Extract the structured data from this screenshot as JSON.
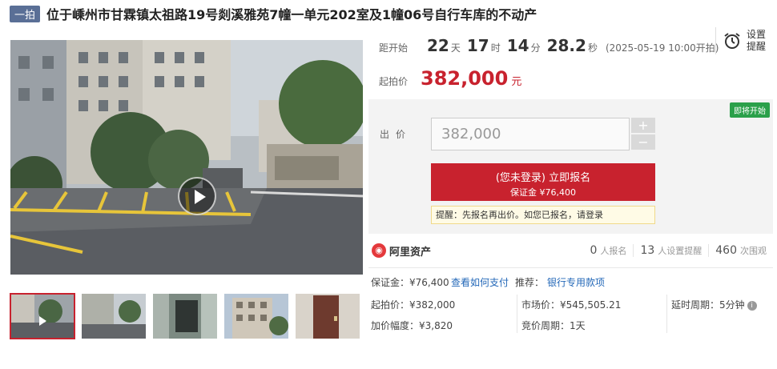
{
  "title": {
    "round_badge": "一拍",
    "text": "位于嵊州市甘霖镇太祖路19号剡溪雅苑7幢一单元202室及1幢06号自行车库的不动产"
  },
  "countdown": {
    "label": "距开始",
    "days": "22",
    "days_unit": "天",
    "hours": "17",
    "hours_unit": "时",
    "minutes": "14",
    "minutes_unit": "分",
    "seconds": "28.2",
    "seconds_unit": "秒",
    "start_time": "(2025-05-19 10:00开拍)"
  },
  "start_price": {
    "label": "起拍价",
    "value": "382,000",
    "unit": "元"
  },
  "remind": {
    "label": "设置提醒",
    "icon": "alarm-clock-icon"
  },
  "bid": {
    "status": "即将开始",
    "label": "出价",
    "input_value": "382,000",
    "plus": "+",
    "minus": "−",
    "signup_main": "(您未登录) 立即报名",
    "signup_sub": "保证金 ¥76,400",
    "hint": "提醒：先报名再出价。如您已报名，请登录"
  },
  "stats": {
    "brand": "阿里资产",
    "signups_count": "0",
    "signups_label": "人报名",
    "reminders_count": "13",
    "reminders_label": "人设置提醒",
    "views_count": "460",
    "views_label": "次围观"
  },
  "details": {
    "deposit": "保证金：¥76,400",
    "how_to_pay": "查看如何支付",
    "recommend_label": "推荐：",
    "recommend_link": "银行专用款项",
    "start_price": "起拍价：¥382,000",
    "increment": "加价幅度：¥3,820",
    "market_price": "市场价：¥545,505.21",
    "auction_period": "竞价周期：1天",
    "extension": "延时周期：5分钟"
  },
  "colors": {
    "accent_red": "#c8222e",
    "status_green": "#2ba04a",
    "badge_blue": "#5a6f96",
    "link_blue": "#2468b8"
  }
}
